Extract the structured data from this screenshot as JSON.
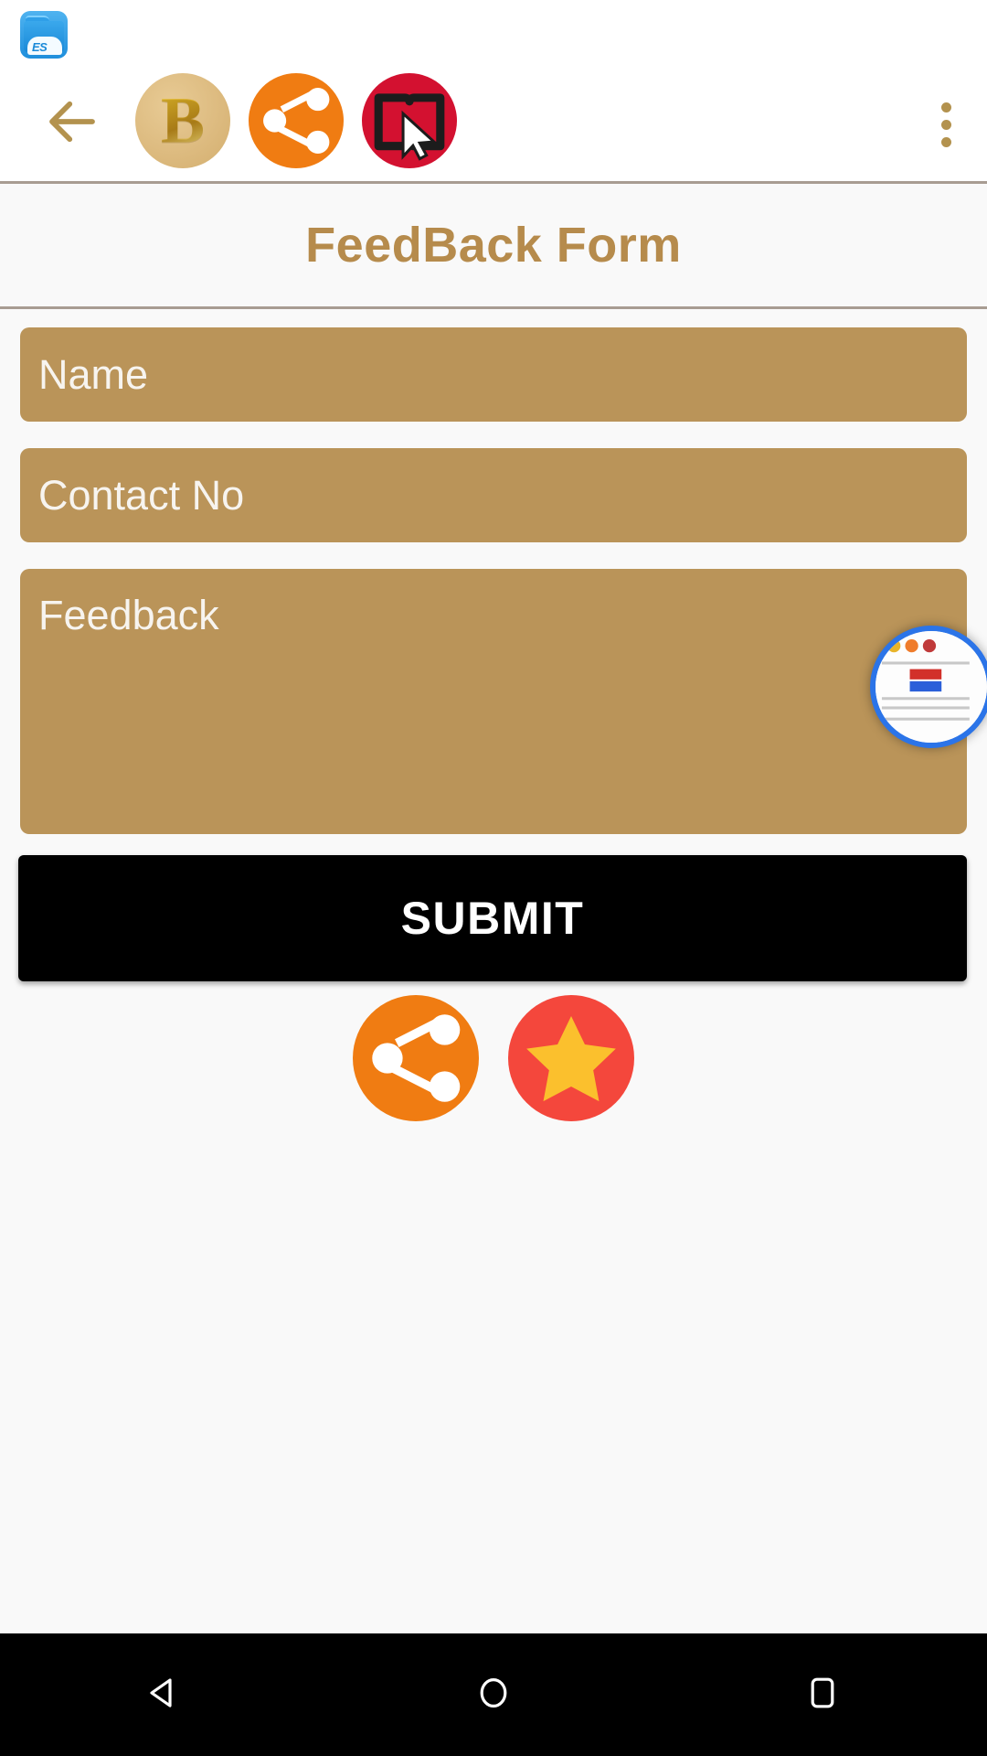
{
  "app": {
    "background_color": "#f9f9f9",
    "accent_color": "#b68b4c",
    "field_color": "#ba9459"
  },
  "status_bar": {
    "notification_icon": "es-file-explorer-icon",
    "es_label": "ES"
  },
  "appbar": {
    "back_icon": "back-arrow-icon",
    "logo_letter": "B",
    "logo_icon": "brand-b-logo-icon",
    "share_icon": "share-icon",
    "book_icon": "book-cursor-icon",
    "overflow_icon": "overflow-menu-icon"
  },
  "header": {
    "title": "FeedBack Form"
  },
  "form": {
    "fields": [
      {
        "name": "name-input",
        "placeholder": "Name",
        "value": ""
      },
      {
        "name": "contact-input",
        "placeholder": "Contact No",
        "value": ""
      },
      {
        "name": "feedback-input",
        "placeholder": "Feedback",
        "value": ""
      }
    ],
    "submit_label": "SUBMIT"
  },
  "actions": [
    {
      "name": "share-app-button",
      "icon": "share-icon",
      "color": "#f07c12"
    },
    {
      "name": "rate-app-button",
      "icon": "star-icon",
      "color": "#f4473c"
    }
  ],
  "floating_bubble": {
    "name": "screen-recorder-bubble",
    "ring_color": "#2b74e8"
  },
  "navbar": {
    "back": "nav-back-icon",
    "home": "nav-home-icon",
    "recents": "nav-recents-icon"
  }
}
